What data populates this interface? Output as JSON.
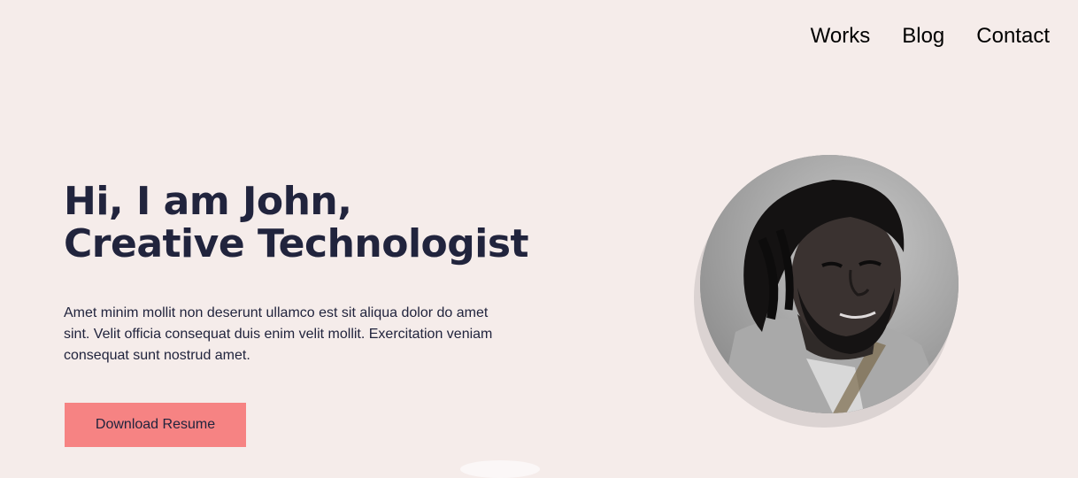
{
  "nav": {
    "items": [
      "Works",
      "Blog",
      "Contact"
    ]
  },
  "hero": {
    "title_line1": "Hi, I am John,",
    "title_line2": "Creative Technologist",
    "description": "Amet minim mollit non deserunt ullamco est sit aliqua dolor do amet sint. Velit officia consequat duis enim velit mollit. Exercitation veniam consequat sunt nostrud amet.",
    "cta_label": "Download Resume"
  },
  "colors": {
    "background": "#f5ecea",
    "heading": "#21243d",
    "button": "#f68383",
    "photo_shadow": "#dbd3d2"
  },
  "icons": {
    "profile": "profile-photo-grayscale"
  }
}
